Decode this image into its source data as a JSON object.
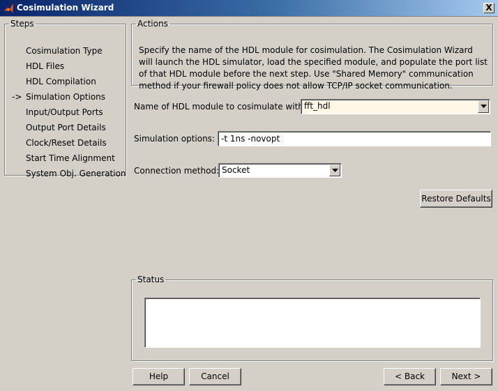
{
  "window": {
    "title": "Cosimulation Wizard",
    "close_glyph": "X",
    "icon": "matlab-logo-icon"
  },
  "steps": {
    "legend": "Steps",
    "current_marker": "->",
    "items": [
      {
        "label": "Cosimulation Type",
        "current": false
      },
      {
        "label": "HDL Files",
        "current": false
      },
      {
        "label": "HDL Compilation",
        "current": false
      },
      {
        "label": "Simulation Options",
        "current": true
      },
      {
        "label": "Input/Output Ports",
        "current": false
      },
      {
        "label": "Output Port Details",
        "current": false
      },
      {
        "label": "Clock/Reset Details",
        "current": false
      },
      {
        "label": "Start Time Alignment",
        "current": false
      },
      {
        "label": "System Obj. Generation",
        "current": false
      }
    ]
  },
  "actions": {
    "legend": "Actions",
    "description": "Specify the name of the HDL module for cosimulation. The Cosimulation Wizard will launch the HDL simulator, load the specified module, and populate the port list of that HDL module before the next step. Use \"Shared Memory\" communication method if your firewall policy does not allow  TCP/IP socket communication."
  },
  "form": {
    "module_label": "Name of HDL module to cosimulate with:",
    "module_value": "fft_hdl",
    "sim_options_label": "Simulation options:",
    "sim_options_value": "-t 1ns -novopt",
    "connection_label": "Connection method:",
    "connection_value": "Socket",
    "restore_defaults": "Restore Defaults"
  },
  "status": {
    "legend": "Status",
    "text": ""
  },
  "buttons": {
    "help": "Help",
    "cancel": "Cancel",
    "back": "< Back",
    "next": "Next >"
  },
  "colors": {
    "title_bar_start": "#0a246a",
    "title_bar_end": "#a6caf0",
    "dialog_bg": "#d4d0c8",
    "module_field_bg": "#fff8e8"
  }
}
